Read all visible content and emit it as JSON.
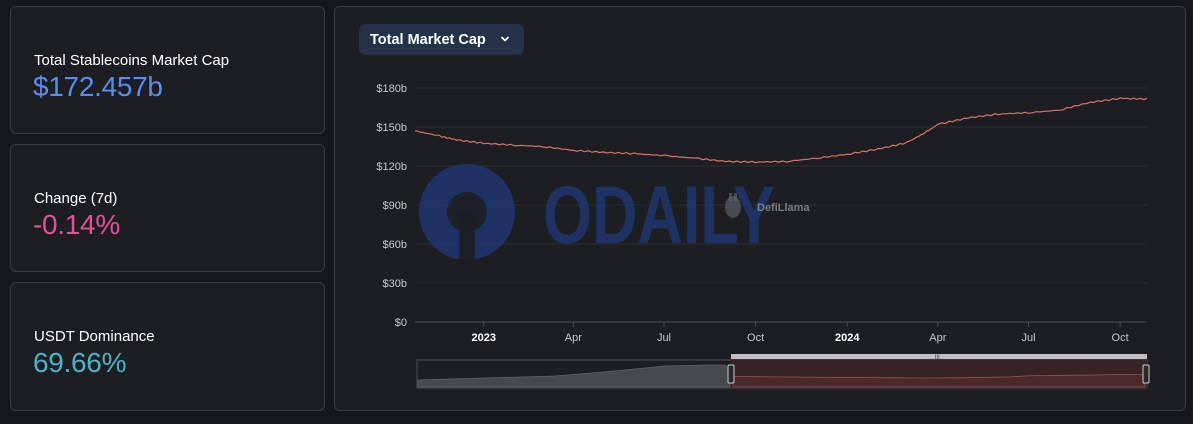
{
  "cards": [
    {
      "label": "Total Stablecoins Market Cap",
      "value": "$172.457b",
      "color": "#5a8def"
    },
    {
      "label": "Change (7d)",
      "value": "-0.14%",
      "color": "#e84f99"
    },
    {
      "label": "USDT Dominance",
      "value": "69.66%",
      "color": "#4fb2c9"
    }
  ],
  "chart": {
    "dropdown_label": "Total Market Cap",
    "watermark": "ODAILY",
    "attribution": "DefiLlama"
  },
  "chart_data": {
    "type": "line",
    "title": "",
    "xlabel": "",
    "ylabel": "",
    "y_ticks": [
      "$180b",
      "$150b",
      "$120b",
      "$90b",
      "$60b",
      "$30b",
      "$0"
    ],
    "y_tick_values": [
      180,
      150,
      120,
      90,
      60,
      30,
      0
    ],
    "ylim": [
      0,
      180
    ],
    "x_tick_labels": [
      "2023",
      "Apr",
      "Jul",
      "Oct",
      "2024",
      "Apr",
      "Jul",
      "Oct"
    ],
    "x_tick_dates": [
      "2023-01-01",
      "2023-04-01",
      "2023-07-01",
      "2023-10-01",
      "2024-01-01",
      "2024-04-01",
      "2024-07-01",
      "2024-10-01"
    ],
    "xlim": [
      "2022-10-24",
      "2024-10-28"
    ],
    "grid": true,
    "line_color": "#d9736b",
    "series": [
      {
        "name": "",
        "x": [
          "2022-10-24",
          "2022-11-15",
          "2022-12-05",
          "2023-01-01",
          "2023-02-01",
          "2023-03-01",
          "2023-04-01",
          "2023-05-01",
          "2023-06-01",
          "2023-07-01",
          "2023-08-01",
          "2023-09-01",
          "2023-10-01",
          "2023-11-01",
          "2023-12-01",
          "2024-01-01",
          "2024-02-01",
          "2024-03-01",
          "2024-03-20",
          "2024-04-01",
          "2024-05-01",
          "2024-06-01",
          "2024-07-01",
          "2024-08-01",
          "2024-09-01",
          "2024-10-01",
          "2024-10-28"
        ],
        "y": [
          147,
          143.5,
          140,
          137.5,
          136,
          135,
          132,
          130.5,
          129.5,
          128,
          126,
          123.5,
          123,
          123.5,
          126,
          129,
          133,
          138,
          146,
          152,
          157,
          160,
          161,
          163,
          169,
          172,
          171.5
        ]
      }
    ],
    "navigator": {
      "left_series": "#9a9a9a",
      "right_series": "#d9736b"
    }
  }
}
